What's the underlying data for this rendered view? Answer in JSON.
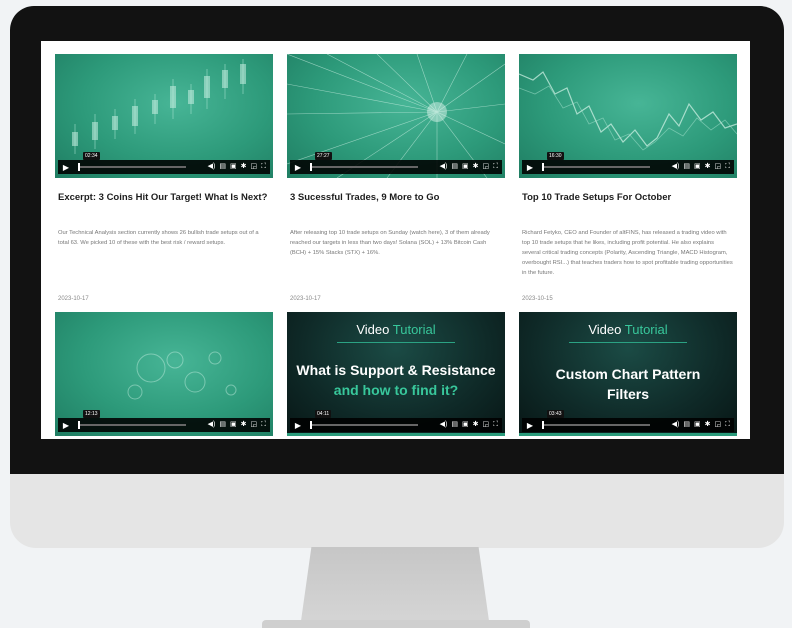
{
  "cards": [
    {
      "title": "Excerpt: 3 Coins Hit Our Target! What Is Next?",
      "excerpt": "Our Technical Analysis section currently shows 26 bullish trade setups out of a total 63. We picked 10 of these with the best risk / reward setups.",
      "date": "2023-10-17",
      "video_time": "02:34"
    },
    {
      "title": "3 Sucessful Trades, 9 More to Go",
      "excerpt": "After releasing top 10 trade setups on Sunday (watch here), 3 of them already reached our targets in less than two days! Solana (SOL) + 13% Bitcoin Cash (BCH) + 15% Stacks (STX) + 16%.",
      "date": "2023-10-17",
      "video_time": "27:27"
    },
    {
      "title": "Top 10 Trade Setups For October",
      "excerpt": "Richard Fetyko, CEO and Founder of altFINS, has released a trading video with top 10 trade setups that he likes, including profit potential. He also explains several critical trading concepts (Polarity, Ascending Triangle, MACD Histogram, overbought RSI...) that teaches traders how to spot profitable trading opportunities in the future.",
      "date": "2023-10-15",
      "video_time": "16:30"
    },
    {
      "video_time": "12:13"
    },
    {
      "video_time": "04:11",
      "tutorial_head": "Video",
      "tutorial_accent": "Tutorial",
      "tutorial_title_1": "What is Support & Resistance",
      "tutorial_title_2": "and how to find it?"
    },
    {
      "video_time": "03:43",
      "tutorial_head": "Video",
      "tutorial_accent": "Tutorial",
      "tutorial_title_1": "Custom Chart Pattern",
      "tutorial_title_2": "Filters"
    }
  ],
  "icons": {
    "play": "play-icon",
    "volume": "volume-icon",
    "captions": "captions-icon",
    "chapters": "chapters-icon",
    "settings": "gear-icon",
    "pip": "pip-icon",
    "fullscreen": "fullscreen-icon"
  },
  "colors": {
    "brand_teal": "#2d9a7a",
    "accent_green": "#38c79b",
    "bezel": "#121212"
  }
}
